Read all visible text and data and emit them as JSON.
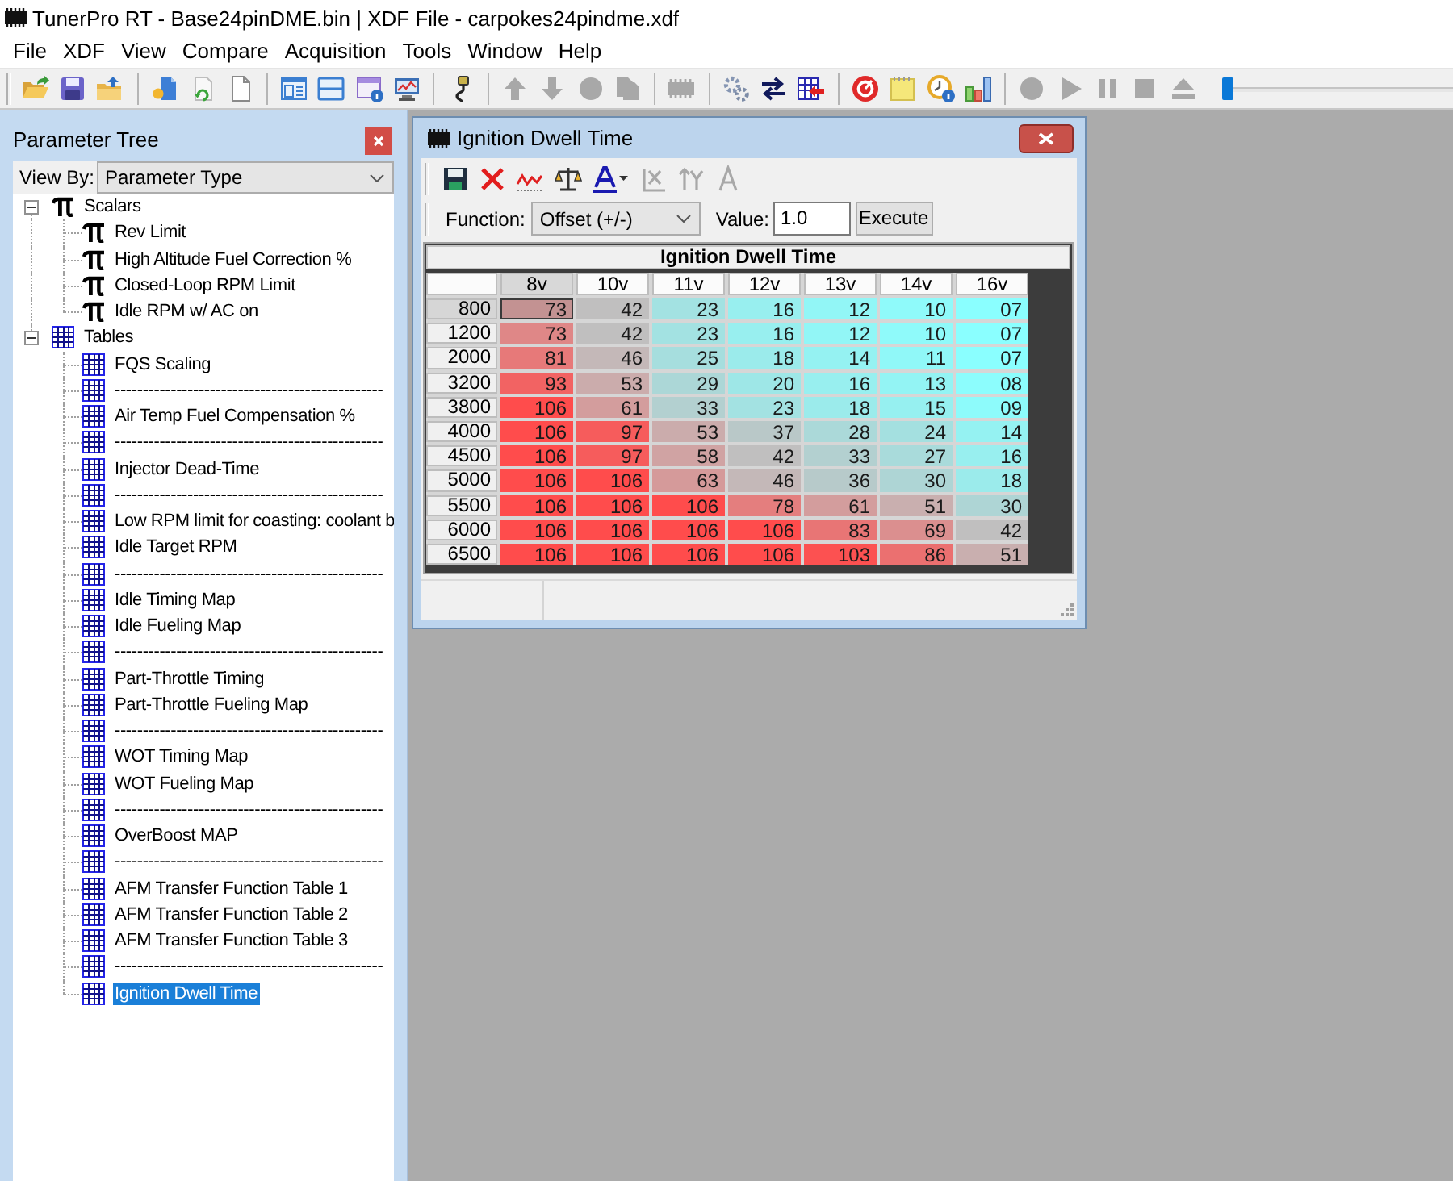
{
  "window": {
    "title": "TunerPro RT - Base24pinDME.bin | XDF File - carpokes24pindme.xdf"
  },
  "menu": [
    "File",
    "XDF",
    "View",
    "Compare",
    "Acquisition",
    "Tools",
    "Window",
    "Help"
  ],
  "toolbar": {
    "groups": [
      [
        {
          "kind": "open",
          "disabled": false
        },
        {
          "kind": "disk",
          "disabled": false
        },
        {
          "kind": "folder",
          "disabled": false
        }
      ],
      [
        {
          "kind": "file",
          "disabled": false
        },
        {
          "kind": "refresh",
          "disabled": false
        },
        {
          "kind": "page",
          "disabled": false
        }
      ],
      [
        {
          "kind": "panels",
          "disabled": false
        },
        {
          "kind": "split",
          "disabled": false
        },
        {
          "kind": "info",
          "disabled": false
        },
        {
          "kind": "monitor",
          "disabled": false
        }
      ],
      [
        {
          "kind": "cable",
          "disabled": false
        }
      ],
      [
        {
          "kind": "up",
          "disabled": true
        },
        {
          "kind": "down",
          "disabled": true
        },
        {
          "kind": "dot",
          "disabled": true
        },
        {
          "kind": "copy",
          "disabled": true
        }
      ],
      [
        {
          "kind": "chip",
          "disabled": true
        }
      ],
      [
        {
          "kind": "gears",
          "disabled": false
        },
        {
          "kind": "swap",
          "disabled": false
        },
        {
          "kind": "import",
          "disabled": false
        }
      ],
      [
        {
          "kind": "gauge",
          "disabled": false
        },
        {
          "kind": "notes",
          "disabled": false
        },
        {
          "kind": "clock",
          "disabled": false
        },
        {
          "kind": "chart",
          "disabled": false
        }
      ],
      [
        {
          "kind": "record",
          "disabled": true
        },
        {
          "kind": "play",
          "disabled": true
        },
        {
          "kind": "pause",
          "disabled": true
        },
        {
          "kind": "stop",
          "disabled": true
        },
        {
          "kind": "eject",
          "disabled": true
        }
      ]
    ],
    "slider": {
      "level": 0
    }
  },
  "parameter_tree": {
    "title": "Parameter Tree",
    "view_by": {
      "label": "View By:",
      "value": "Parameter Type"
    },
    "items": [
      {
        "label": "Scalars",
        "kind": "scalar",
        "expanded": true,
        "selected": false,
        "children": [
          {
            "label": "Rev Limit",
            "kind": "scalar",
            "selected": false
          },
          {
            "label": "High Altitude Fuel Correction %",
            "kind": "scalar",
            "selected": false
          },
          {
            "label": "Closed-Loop RPM Limit",
            "kind": "scalar",
            "selected": false
          },
          {
            "label": "Idle RPM w/ AC on",
            "kind": "scalar",
            "selected": false
          }
        ]
      },
      {
        "label": "Tables",
        "kind": "table",
        "expanded": true,
        "selected": false,
        "children": [
          {
            "label": "FQS Scaling",
            "kind": "table",
            "selected": false
          },
          {
            "label": "------------------------------------------------",
            "kind": "table",
            "selected": false
          },
          {
            "label": "Air Temp Fuel Compensation %",
            "kind": "table",
            "selected": false
          },
          {
            "label": "------------------------------------------------",
            "kind": "table",
            "selected": false
          },
          {
            "label": "Injector Dead-Time",
            "kind": "table",
            "selected": false
          },
          {
            "label": "------------------------------------------------",
            "kind": "table",
            "selected": false
          },
          {
            "label": "Low RPM limit for coasting: coolant b",
            "kind": "table",
            "selected": false
          },
          {
            "label": "Idle Target RPM",
            "kind": "table",
            "selected": false
          },
          {
            "label": "------------------------------------------------",
            "kind": "table",
            "selected": false
          },
          {
            "label": "Idle Timing Map",
            "kind": "table",
            "selected": false
          },
          {
            "label": "Idle Fueling Map",
            "kind": "table",
            "selected": false
          },
          {
            "label": "------------------------------------------------",
            "kind": "table",
            "selected": false
          },
          {
            "label": "Part-Throttle Timing",
            "kind": "table",
            "selected": false
          },
          {
            "label": "Part-Throttle Fueling Map",
            "kind": "table",
            "selected": false
          },
          {
            "label": "------------------------------------------------",
            "kind": "table",
            "selected": false
          },
          {
            "label": "WOT Timing Map",
            "kind": "table",
            "selected": false
          },
          {
            "label": "WOT Fueling Map",
            "kind": "table",
            "selected": false
          },
          {
            "label": "------------------------------------------------",
            "kind": "table",
            "selected": false
          },
          {
            "label": "OverBoost MAP",
            "kind": "table",
            "selected": false
          },
          {
            "label": "------------------------------------------------",
            "kind": "table",
            "selected": false
          },
          {
            "label": "AFM Transfer Function Table 1",
            "kind": "table",
            "selected": false
          },
          {
            "label": "AFM Transfer Function Table 2",
            "kind": "table",
            "selected": false
          },
          {
            "label": "AFM Transfer Function Table 3",
            "kind": "table",
            "selected": false
          },
          {
            "label": "------------------------------------------------",
            "kind": "table",
            "selected": false
          },
          {
            "label": "Ignition Dwell Time",
            "kind": "table",
            "selected": true
          }
        ]
      }
    ]
  },
  "table_window": {
    "title": "Ignition Dwell Time",
    "toolbar": [
      {
        "kind": "save",
        "disabled": false
      },
      {
        "kind": "delete",
        "disabled": false
      },
      {
        "kind": "graph",
        "disabled": false
      },
      {
        "kind": "scales",
        "disabled": false
      },
      {
        "kind": "textcolor",
        "disabled": false
      },
      {
        "kind": "xaxis",
        "disabled": true
      },
      {
        "kind": "yaxis",
        "disabled": true
      },
      {
        "kind": "font",
        "disabled": true
      }
    ],
    "function": {
      "label": "Function:",
      "value": "Offset (+/-)"
    },
    "value_field": {
      "label": "Value:",
      "value": "1.0"
    },
    "execute_button": "Execute",
    "table": {
      "title": "Ignition Dwell Time",
      "columns": [
        {
          "label": "8v",
          "selected": true
        },
        {
          "label": "10v",
          "selected": false
        },
        {
          "label": "11v",
          "selected": false
        },
        {
          "label": "12v",
          "selected": false
        },
        {
          "label": "13v",
          "selected": false
        },
        {
          "label": "14v",
          "selected": false
        },
        {
          "label": "16v",
          "selected": false
        }
      ],
      "rows": [
        {
          "label": "800",
          "selected": true,
          "cells": [
            "73",
            "42",
            "23",
            "16",
            "12",
            "10",
            "07"
          ]
        },
        {
          "label": "1200",
          "selected": false,
          "cells": [
            "73",
            "42",
            "23",
            "16",
            "12",
            "10",
            "07"
          ]
        },
        {
          "label": "2000",
          "selected": false,
          "cells": [
            "81",
            "46",
            "25",
            "18",
            "14",
            "11",
            "07"
          ]
        },
        {
          "label": "3200",
          "selected": false,
          "cells": [
            "93",
            "53",
            "29",
            "20",
            "16",
            "13",
            "08"
          ]
        },
        {
          "label": "3800",
          "selected": false,
          "cells": [
            "106",
            "61",
            "33",
            "23",
            "18",
            "15",
            "09"
          ]
        },
        {
          "label": "4000",
          "selected": false,
          "cells": [
            "106",
            "97",
            "53",
            "37",
            "28",
            "24",
            "14"
          ]
        },
        {
          "label": "4500",
          "selected": false,
          "cells": [
            "106",
            "97",
            "58",
            "42",
            "33",
            "27",
            "16"
          ]
        },
        {
          "label": "5000",
          "selected": false,
          "cells": [
            "106",
            "106",
            "63",
            "46",
            "36",
            "30",
            "18"
          ]
        },
        {
          "label": "5500",
          "selected": false,
          "cells": [
            "106",
            "106",
            "106",
            "78",
            "61",
            "51",
            "30"
          ]
        },
        {
          "label": "6000",
          "selected": false,
          "cells": [
            "106",
            "106",
            "106",
            "106",
            "83",
            "69",
            "42"
          ]
        },
        {
          "label": "6500",
          "selected": false,
          "cells": [
            "106",
            "106",
            "106",
            "106",
            "103",
            "86",
            "51"
          ]
        }
      ]
    }
  }
}
